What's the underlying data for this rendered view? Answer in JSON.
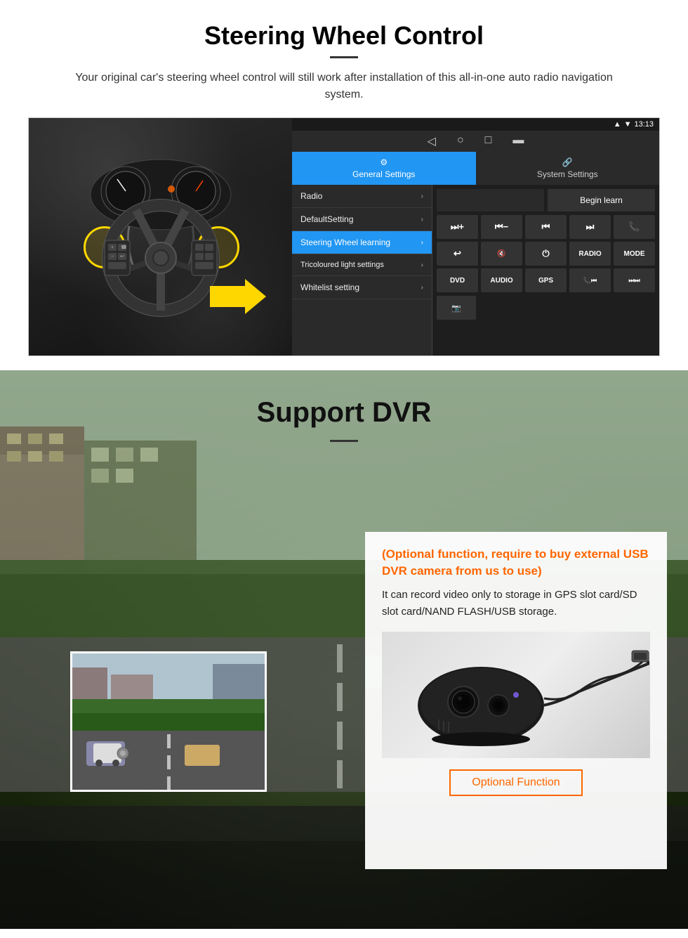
{
  "swc": {
    "title": "Steering Wheel Control",
    "subtitle": "Your original car's steering wheel control will still work after installation of this all-in-one auto radio navigation system.",
    "status_bar": {
      "time": "13:13",
      "icons": [
        "signal",
        "wifi",
        "battery"
      ]
    },
    "nav_icons": [
      "◁",
      "○",
      "□",
      "▬"
    ],
    "tabs": [
      {
        "label": "General Settings",
        "active": true,
        "icon": "⚙"
      },
      {
        "label": "System Settings",
        "active": false,
        "icon": "🔗"
      }
    ],
    "menu_items": [
      {
        "label": "Radio",
        "active": false
      },
      {
        "label": "DefaultSetting",
        "active": false
      },
      {
        "label": "Steering Wheel learning",
        "active": true
      },
      {
        "label": "Tricoloured light settings",
        "active": false
      },
      {
        "label": "Whitelist setting",
        "active": false
      }
    ],
    "begin_learn_label": "Begin learn",
    "ctrl_buttons": [
      "⏭+",
      "⏮−",
      "⏮⏮",
      "⏭⏭",
      "📞",
      "↩",
      "🔇×",
      "⏻",
      "RADIO",
      "MODE",
      "DVD",
      "AUDIO",
      "GPS",
      "📞⏮",
      "⏭⏭"
    ],
    "last_row_btn": "📷"
  },
  "dvr": {
    "title": "Support DVR",
    "optional_text": "(Optional function, require to buy external USB DVR camera from us to use)",
    "desc_text": "It can record video only to storage in GPS slot card/SD slot card/NAND FLASH/USB storage.",
    "optional_btn_label": "Optional Function",
    "camera_alt": "DVR Camera device"
  }
}
